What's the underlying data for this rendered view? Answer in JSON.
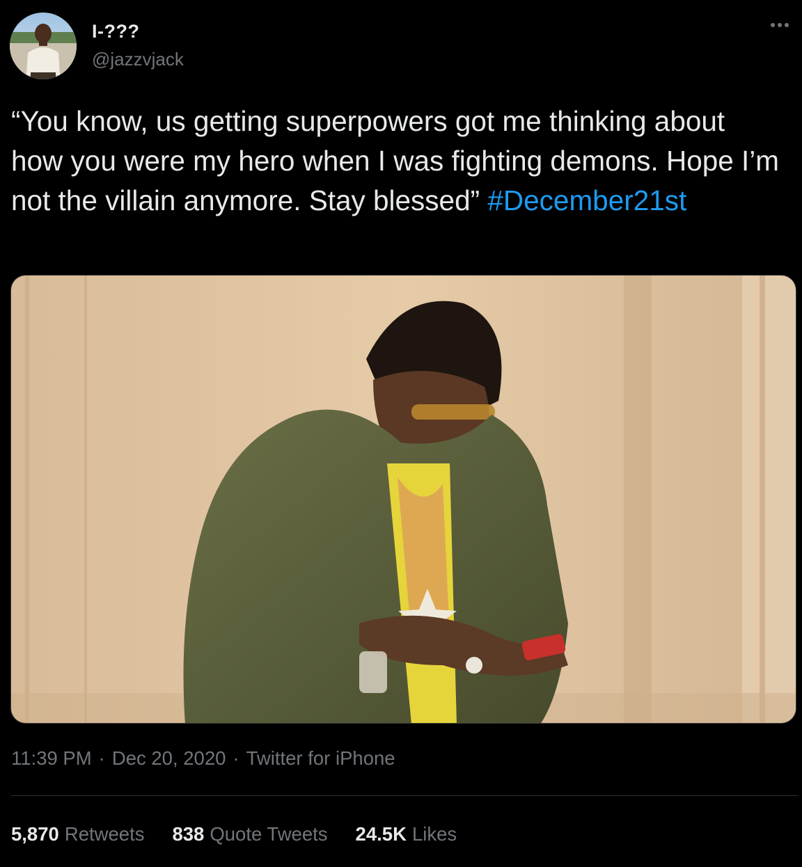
{
  "author": {
    "display_name": "I-???",
    "handle": "@jazzvjack",
    "avatar_icon": "user-avatar-photo"
  },
  "more_icon": "ellipsis-icon",
  "tweet": {
    "text": "“You know, us getting superpowers got me thinking about how you were my hero when I was fighting demons. Hope I’m not the villain anymore. Stay blessed”",
    "hashtag": "#December21st"
  },
  "media": {
    "kind": "photo"
  },
  "meta": {
    "time": "11:39 PM",
    "separator": "·",
    "date": "Dec 20, 2020",
    "source": "Twitter for iPhone"
  },
  "stats": {
    "retweets_count": "5,870",
    "retweets_label": "Retweets",
    "quotes_count": "838",
    "quotes_label": "Quote Tweets",
    "likes_count": "24.5K",
    "likes_label": "Likes"
  },
  "colors": {
    "background": "#000000",
    "text": "#e7e9ea",
    "secondary": "#71767b",
    "link": "#1d9bf0",
    "divider": "#2f3336"
  }
}
